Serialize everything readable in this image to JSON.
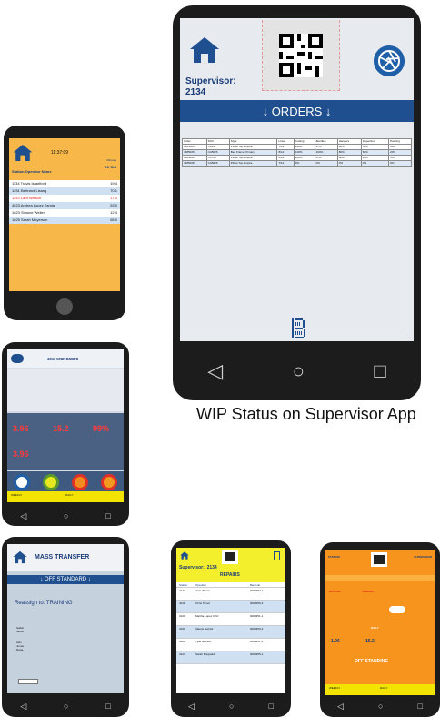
{
  "caption": "WIP Status on Supervisor App",
  "main_phone": {
    "supervisor_label": "Supervisor:",
    "supervisor_id": "2134",
    "orders_title": "↓ ORDERS ↓",
    "table": {
      "headers": [
        "Order",
        "SOC",
        "Style",
        "Lines",
        "Cutting",
        "Bundles",
        "Hangers",
        "Inspection",
        "Packing"
      ],
      "rows": [
        [
          "4385024",
          "TR69",
          "Pillow Top Empire",
          "7/12",
          "100%",
          "87%",
          "60%",
          "50%",
          "10%"
        ],
        [
          "4385025",
          "CLB026",
          "Bed Frame Primary",
          "8/12",
          "100%",
          "100%",
          "80%",
          "60%",
          "20%"
        ],
        [
          "4385026",
          "TR760",
          "Pillow Top Empire",
          "6/12",
          "100%",
          "87%",
          "60%",
          "40%",
          "15%"
        ],
        [
          "4385028",
          "CLB026",
          "Pillow Top Empire",
          "7/12",
          "0%",
          "0%",
          "0%",
          "0%",
          "0%"
        ]
      ]
    },
    "nav": [
      "◁",
      "○",
      "□"
    ]
  },
  "phone_a": {
    "time": "11:37:09",
    "col_left": "Station Operator Name",
    "col_right_top": "Minutes",
    "col_right": "Off Std",
    "rows": [
      {
        "text": "1134 Travis Israelford",
        "val": "19.4"
      },
      {
        "text": "1251 Bertrand Lisang",
        "val": "70.1"
      },
      {
        "text": "1193 Lara Watson",
        "val": "17.0"
      },
      {
        "text": "4523 Andrea Lopez Zamia",
        "val": "53.0"
      },
      {
        "text": "1623 Simone Weller",
        "val": "12.4"
      },
      {
        "text": "1625 Sarah Moyerson",
        "val": "65.0"
      }
    ]
  },
  "phone_b": {
    "title": "4543 Sean Ballard",
    "metric_1": "3.96",
    "metric_2": "15.2",
    "metric_3": "99%",
    "metric_4": "3.96",
    "footer_left": "WEEKLY",
    "footer_right": "DAILY"
  },
  "phone_c": {
    "title": "MASS TRANSFER",
    "bar": "↓ OFF STANDARD ↓",
    "center": "Reassign to: TRAINING",
    "items": [
      "Isabel",
      "Jacob",
      "Alex",
      "Jonas",
      "Dana"
    ]
  },
  "phone_d": {
    "supervisor": "Supervisor:",
    "supervisor_id": "2134",
    "title": "REPAIRS",
    "headers": [
      "Station",
      "Operator",
      "Barcode"
    ],
    "rows": [
      [
        "4143",
        "Jack Wilson",
        "0004352-1"
      ],
      [
        "4011",
        "Chris Tamer",
        "0004356-3"
      ],
      [
        "4129",
        "Martha Lopez Ortiz",
        "0004351-1"
      ],
      [
        "4160",
        "Valerie Garrett",
        "0004353-2"
      ],
      [
        "4120",
        "Tyler Ericson",
        "0004357-4"
      ],
      [
        "4123",
        "Sarah Burgaard",
        "0004355-1"
      ]
    ]
  },
  "phone_e": {
    "top_left": "STATION",
    "top_right": "SUPERVISOR",
    "label_1": "BEFORE",
    "label_2": "PENDING",
    "value_1": "1.96",
    "value_2": "15.2",
    "header_mid": "DAILY",
    "off_standing": "OFF STANDING",
    "footer_left": "WEEKLY",
    "footer_right": "DAILY"
  },
  "colors": {
    "navy": "#1f4f8f",
    "orange": "#f7b849",
    "deep_orange": "#f7941d",
    "yellow": "#f4ef2c"
  }
}
